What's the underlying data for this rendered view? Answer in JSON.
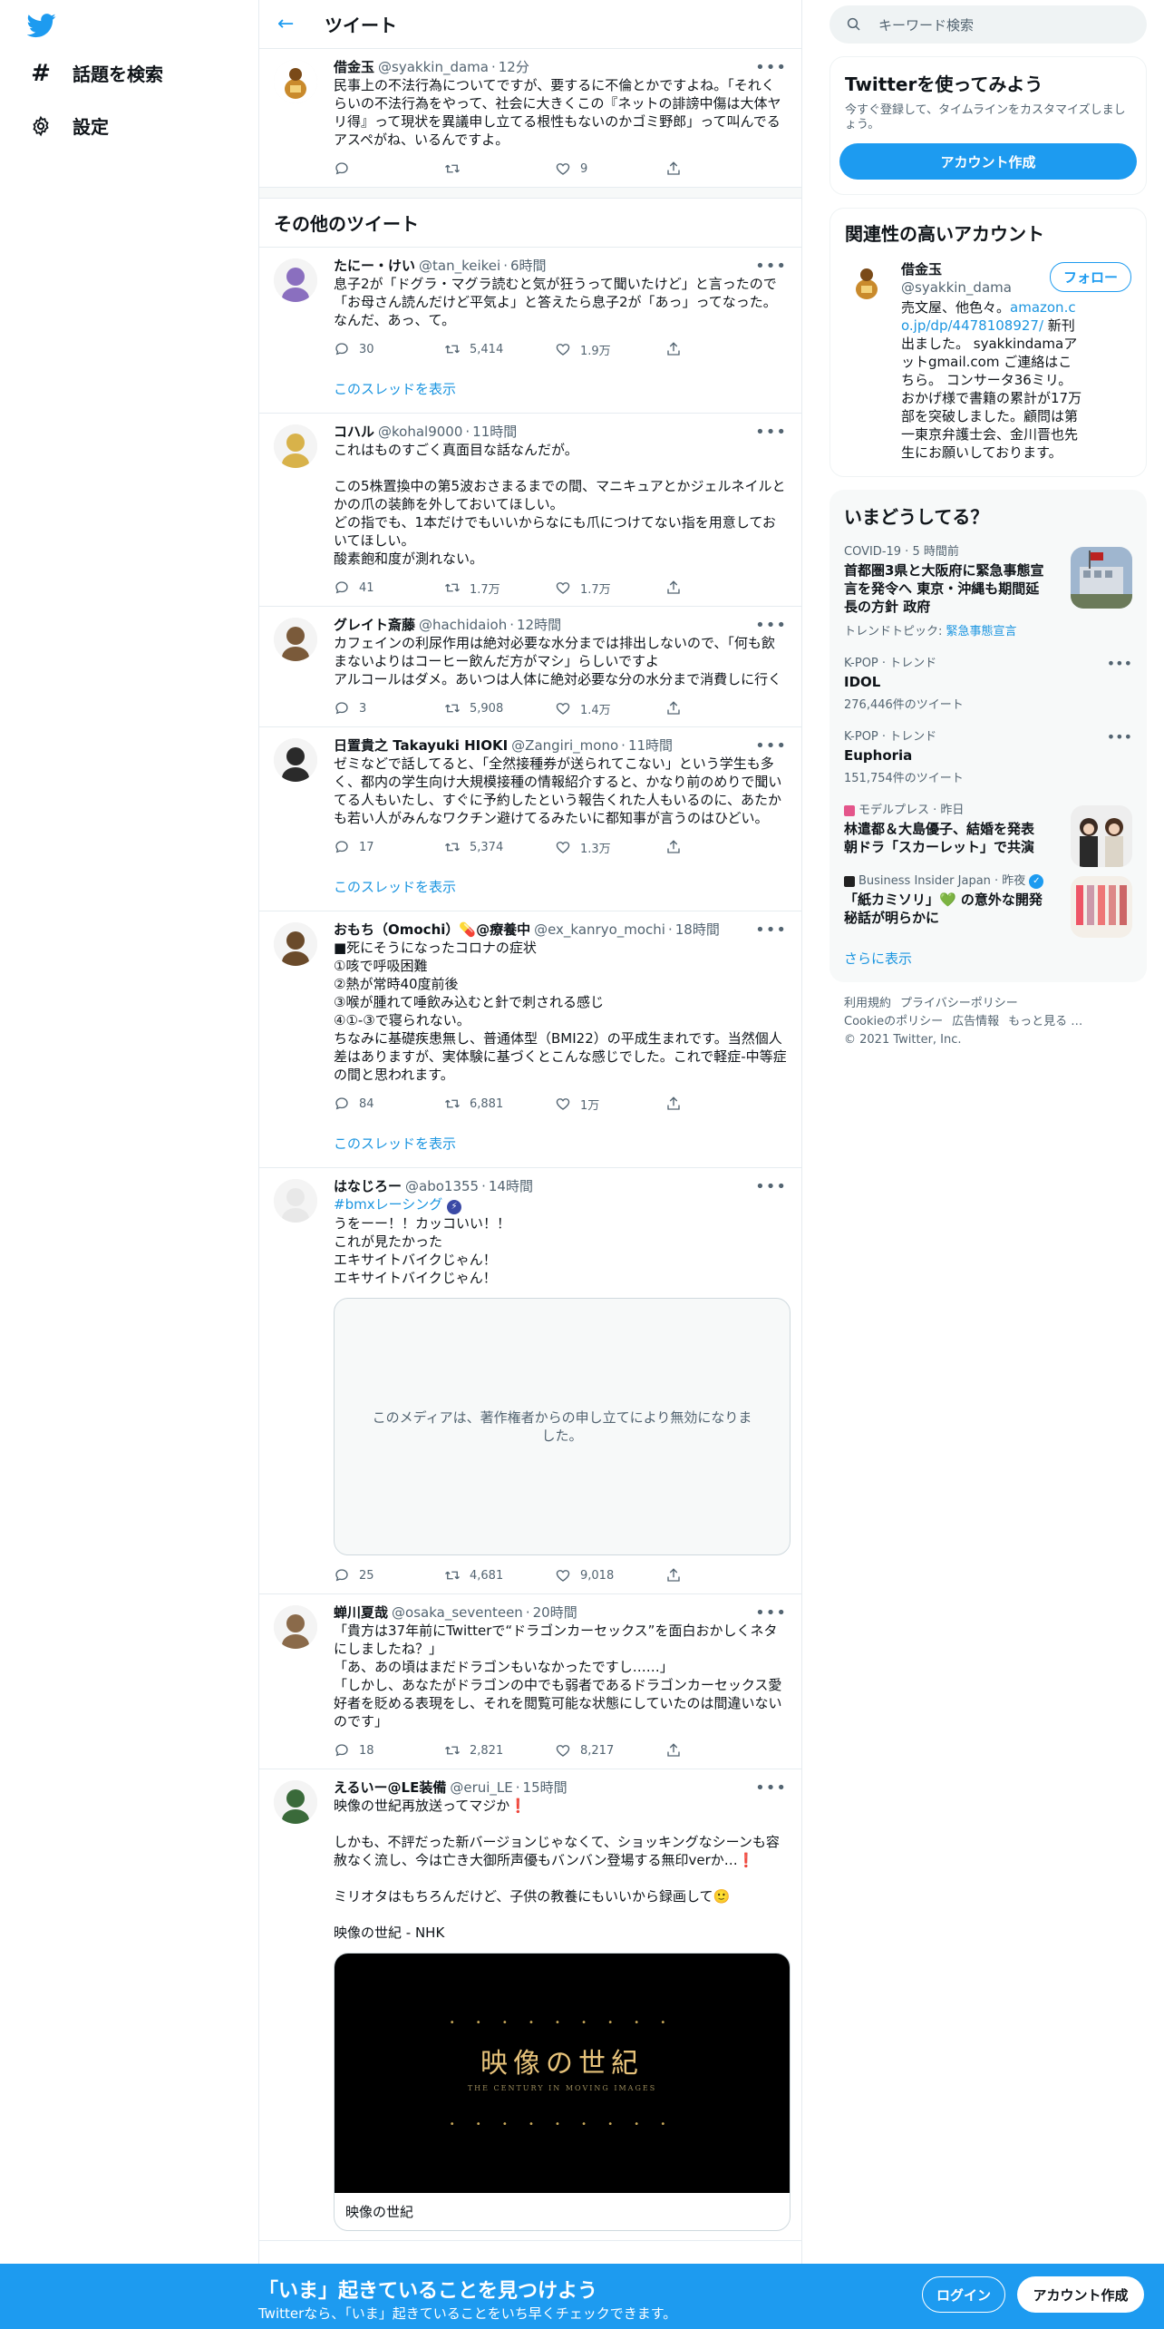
{
  "nav": {
    "explore_label": "話題を検索",
    "settings_label": "設定"
  },
  "header": {
    "title": "ツイート"
  },
  "main_tweet": {
    "name": "借金玉",
    "handle": "@syakkin_dama",
    "time": "12分",
    "body": "民事上の不法行為についてですが、要するに不倫とかですよね。「それくらいの不法行為をやって、社会に大きくこの『ネットの誹謗中傷は大体ヤリ得』って現状を異議申し立てる根性もないのかゴミ野郎」って叫んでるアスペがね、いるんですよ。",
    "likes": "9"
  },
  "section_title": "その他のツイート",
  "thread_link_label": "このスレッドを表示",
  "tweets": [
    {
      "name": "たにー・けい",
      "handle": "@tan_keikei",
      "time": "6時間",
      "body": "息子2が「ドグラ・マグラ読むと気が狂うって聞いたけど」と言ったので「お母さん読んだけど平気よ」と答えたら息子2が「あっ」ってなった。なんだ、あっ、て。",
      "replies": "30",
      "retweets": "5,414",
      "likes": "1.9万"
    },
    {
      "name": "コハル",
      "handle": "@kohal9000",
      "time": "11時間",
      "body": "これはものすごく真面目な話なんだが。\n\nこの5株置換中の第5波おさまるまでの間、マニキュアとかジェルネイルとかの爪の装飾を外しておいてほしい。\nどの指でも、1本だけでもいいからなにも爪につけてない指を用意しておいてほしい。\n酸素飽和度が測れない。",
      "replies": "41",
      "retweets": "1.7万",
      "likes": "1.7万"
    },
    {
      "name": "グレイト斎藤",
      "handle": "@hachidaioh",
      "time": "12時間",
      "body": "カフェインの利尿作用は絶対必要な水分までは排出しないので、「何も飲まないよりはコーヒー飲んだ方がマシ」らしいですよ\nアルコールはダメ。あいつは人体に絶対必要な分の水分まで消費しに行く",
      "replies": "3",
      "retweets": "5,908",
      "likes": "1.4万"
    },
    {
      "name": "日置貴之 Takayuki HIOKI",
      "handle": "@Zangiri_mono",
      "time": "11時間",
      "body": "ゼミなどで話してると、「全然接種券が送られてこない」という学生も多く、都内の学生向け大規模接種の情報紹介すると、かなり前のめりで聞いてる人もいたし、すぐに予約したという報告くれた人もいるのに、あたかも若い人がみんなワクチン避けてるみたいに都知事が言うのはひどい。",
      "replies": "17",
      "retweets": "5,374",
      "likes": "1.3万"
    },
    {
      "name": "おもち（Omochi）💊@療養中",
      "handle": "@ex_kanryo_mochi",
      "time": "18時間",
      "body": "■死にそうになったコロナの症状\n①咳で呼吸困難\n②熱が常時40度前後\n③喉が腫れて唾飲み込むと針で刺される感じ\n④①-③で寝られない。\nちなみに基礎疾患無し、普通体型（BMI22）の平成生まれです。当然個人差はありますが、実体験に基づくとこんな感じでした。これで軽症-中等症の間と思われます。",
      "replies": "84",
      "retweets": "6,881",
      "likes": "1万"
    },
    {
      "name": "はなじろー",
      "handle": "@abo1355",
      "time": "14時間",
      "hashtag": "#bmxレーシング",
      "body": "うをーー！！カッコいい！！\nこれが見たかった\nエキサイトバイクじゃん！\nエキサイトバイクじゃん！",
      "media_notice": "このメディアは、著作権者からの申し立てにより無効になりました。",
      "replies": "25",
      "retweets": "4,681",
      "likes": "9,018"
    },
    {
      "name": "蝉川夏哉",
      "handle": "@osaka_seventeen",
      "time": "20時間",
      "body": "「貴方は37年前にTwitterで“ドラゴンカーセックス”を面白おかしくネタにしましたね？」\n「あ、あの頃はまだドラゴンもいなかったですし……」\n「しかし、あなたがドラゴンの中でも弱者であるドラゴンカーセックス愛好者を貶める表現をし、それを閲覧可能な状態にしていたのは間違いないのです」",
      "replies": "18",
      "retweets": "2,821",
      "likes": "8,217"
    },
    {
      "name": "えるいー@LE装備",
      "handle": "@erui_LE",
      "time": "15時間",
      "body": "映像の世紀再放送ってマジか❗\n\nしかも、不評だった新バージョンじゃなくて、ショッキングなシーンも容赦なく流し、今は亡き大御所声優もバンバン登場する無印verか…❗\n\nミリオタはもちろんだけど、子供の教養にもいいから録画して🙂\n\n映像の世紀 - NHK",
      "card_image_title": "映像の世紀",
      "card_image_sub": "THE CENTURY IN MOVING IMAGES",
      "card_title": "映像の世紀"
    }
  ],
  "search": {
    "placeholder": "キーワード検索"
  },
  "signup_panel": {
    "title": "Twitterを使ってみよう",
    "subtitle": "今すぐ登録して、タイムラインをカスタマイズしましょう。",
    "button": "アカウント作成"
  },
  "related": {
    "title": "関連性の高いアカウント",
    "name": "借金玉",
    "handle": "@syakkin_dama",
    "follow": "フォロー",
    "bio_pre": "売文屋、他色々。",
    "bio_link1": "amazon.co.jp/dp/4478108927/",
    "bio_mid": " 新刊出ました。 syakkindamaアットgmail.com",
    "bio_post": " ご連絡はこちら。 コンサータ36ミリ。おかげ様で書籍の累計が17万部を突破しました。顧問は第一東京弁護士会、金川晋也先生にお願いしております。"
  },
  "trends": {
    "title": "いまどうしてる？",
    "items": [
      {
        "meta": "COVID-19 · 5 時間前",
        "title": "首都圏3県と大阪府に緊急事態宣言を発令へ 東京・沖縄も期間延長の方針 政府",
        "topic_label": "トレンドトピック: ",
        "topic_link": "緊急事態宣言"
      },
      {
        "meta": "K-POP · トレンド",
        "title": "IDOL",
        "count": "276,446件のツイート"
      },
      {
        "meta": "K-POP · トレンド",
        "title": "Euphoria",
        "count": "151,754件のツイート"
      },
      {
        "meta": "モデルプレス · 昨日",
        "title": "林遣都＆大島優子、結婚を発表 朝ドラ「スカーレット」で共演"
      },
      {
        "meta": "Business Insider Japan · 昨夜",
        "title": "「紙カミソリ」💚 の意外な開発秘話が明らかに"
      }
    ],
    "show_more": "さらに表示"
  },
  "footer": {
    "links": [
      "利用規約",
      "プライバシーポリシー",
      "Cookieのポリシー",
      "広告情報",
      "もっと見る …"
    ],
    "copyright": "© 2021 Twitter, Inc."
  },
  "bottom_bar": {
    "title": "「いま」起きていることを見つけよう",
    "subtitle": "Twitterなら、「いま」起きていることをいち早くチェックできます。",
    "login": "ログイン",
    "signup": "アカウント作成"
  },
  "colors": {
    "accent": "#1d9bf0",
    "link": "#1b95e0",
    "muted": "#536471"
  }
}
